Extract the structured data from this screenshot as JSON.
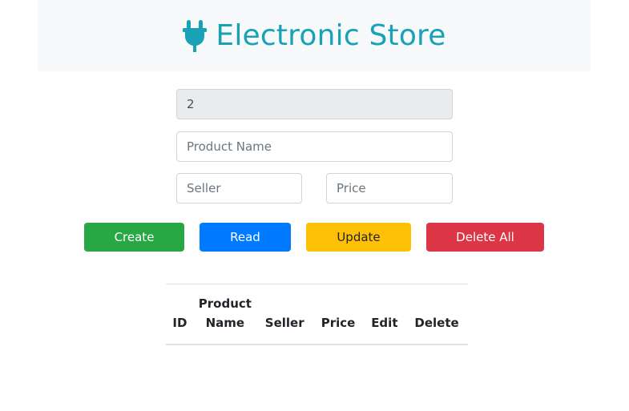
{
  "header": {
    "title": "Electronic Store",
    "icon": "plug-icon",
    "accent_color": "#17a2b8",
    "background": "#f8f9fa"
  },
  "form": {
    "id_field": {
      "value": "2"
    },
    "product_name": {
      "placeholder": "Product Name",
      "value": ""
    },
    "seller": {
      "placeholder": "Seller",
      "value": ""
    },
    "price": {
      "placeholder": "Price",
      "value": ""
    }
  },
  "buttons": {
    "create": {
      "label": "Create",
      "color": "#28a745"
    },
    "read": {
      "label": "Read",
      "color": "#007bff"
    },
    "update": {
      "label": "Update",
      "color": "#ffc107"
    },
    "delete_all": {
      "label": "Delete All",
      "color": "#dc3545"
    }
  },
  "table": {
    "columns": [
      "ID",
      "Product Name",
      "Seller",
      "Price",
      "Edit",
      "Delete"
    ],
    "rows": []
  }
}
